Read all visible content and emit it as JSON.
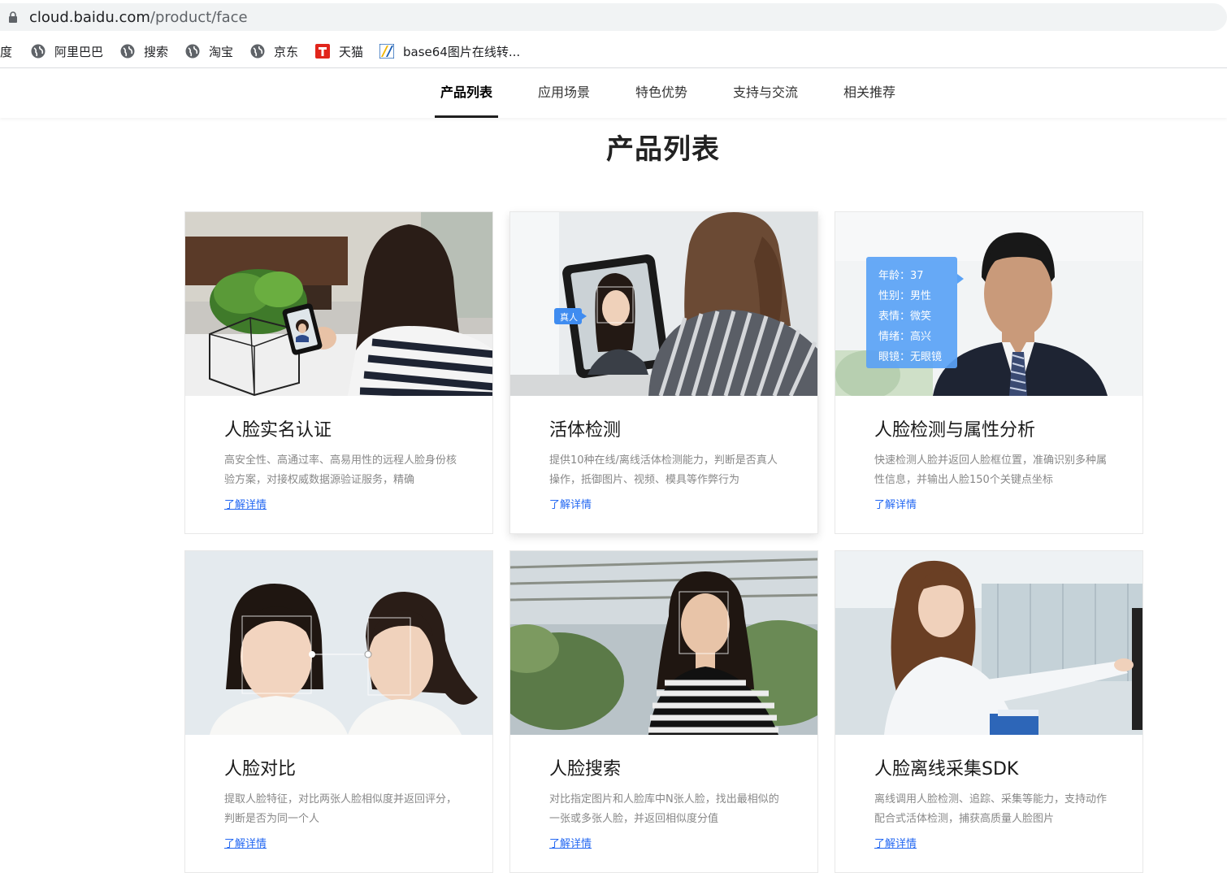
{
  "browser": {
    "url_host": "cloud.baidu.com",
    "url_path": "/product/face",
    "bookmarks": [
      {
        "label": "度",
        "icon": "none"
      },
      {
        "label": "阿里巴巴",
        "icon": "globe-icon"
      },
      {
        "label": "搜索",
        "icon": "globe-icon"
      },
      {
        "label": "淘宝",
        "icon": "globe-icon"
      },
      {
        "label": "京东",
        "icon": "globe-icon"
      },
      {
        "label": "天猫",
        "icon": "tmall-icon"
      },
      {
        "label": "base64图片在线转...",
        "icon": "base64-icon"
      }
    ]
  },
  "subnav": {
    "tabs": [
      {
        "label": "产品列表",
        "active": true
      },
      {
        "label": "应用场景",
        "active": false
      },
      {
        "label": "特色优势",
        "active": false
      },
      {
        "label": "支持与交流",
        "active": false
      },
      {
        "label": "相关推荐",
        "active": false
      }
    ]
  },
  "section": {
    "title": "产品列表"
  },
  "cards": [
    {
      "title": "人脸实名认证",
      "desc": "高安全性、高通过率、高易用性的远程人脸身份核验方案，对接权威数据源验证服务，精确",
      "link": "了解详情"
    },
    {
      "title": "活体检测",
      "desc": "提供10种在线/离线活体检测能力，判断是否真人操作，抵御图片、视频、模具等作弊行为",
      "link": "了解详情",
      "badge": "真人"
    },
    {
      "title": "人脸检测与属性分析",
      "desc": "快速检测人脸并返回人脸框位置，准确识别多种属性信息，并输出人脸150个关键点坐标",
      "link": "了解详情",
      "attributes": [
        "年龄：37",
        "性别：男性",
        "表情：微笑",
        "情绪：高兴",
        "眼镜：无眼镜"
      ]
    },
    {
      "title": "人脸对比",
      "desc": "提取人脸特征，对比两张人脸相似度并返回评分，判断是否为同一个人",
      "link": "了解详情"
    },
    {
      "title": "人脸搜索",
      "desc": "对比指定图片和人脸库中N张人脸，找出最相似的一张或多张人脸，并返回相似度分值",
      "link": "了解详情"
    },
    {
      "title": "人脸离线采集SDK",
      "desc": "离线调用人脸检测、追踪、采集等能力，支持动作配合式活体检测，捕获高质量人脸图片",
      "link": "了解详情"
    }
  ],
  "colors": {
    "link": "#2468f2",
    "badge": "#3f8cf0",
    "active_underline": "#1f1f1f"
  }
}
